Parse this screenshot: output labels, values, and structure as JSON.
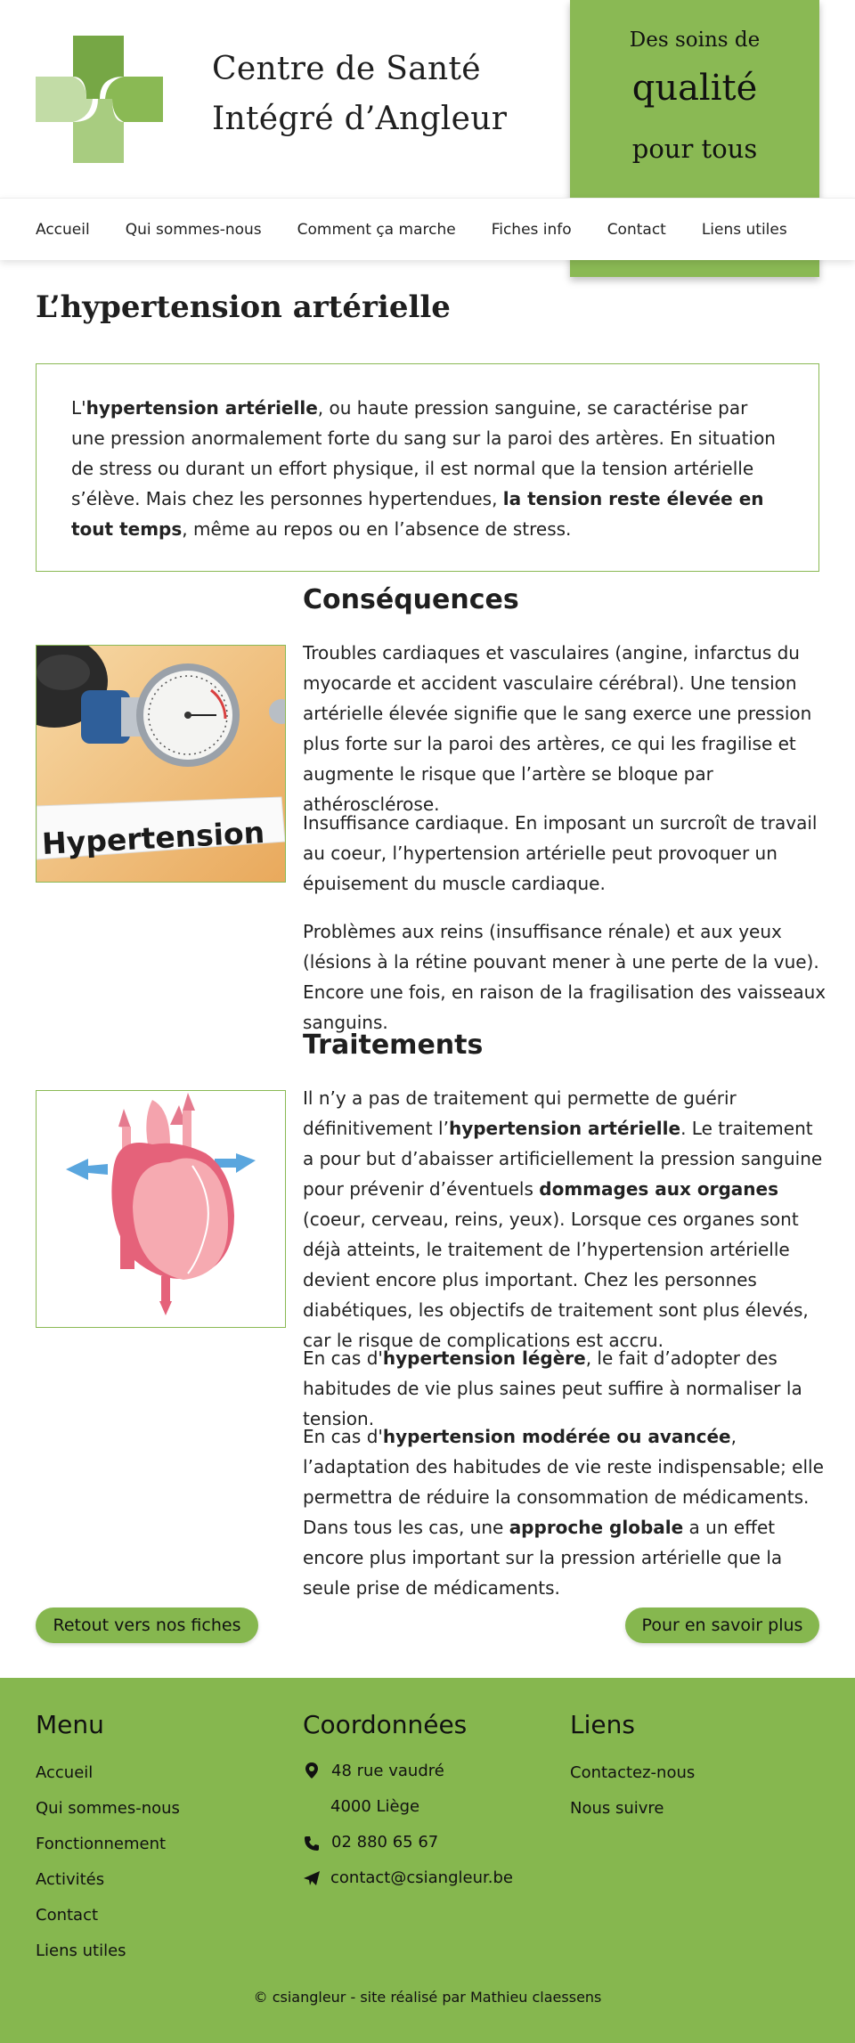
{
  "header": {
    "site_name_line1": "Centre de Santé",
    "site_name_line2": "Intégré d’Angleur",
    "slogan_line1": "Des soins de",
    "slogan_line2": "qualité",
    "slogan_line3": "pour tous",
    "logo_icon": "green-cross-logo"
  },
  "nav": {
    "items": [
      "Accueil",
      "Qui sommes-nous",
      "Comment ça marche",
      "Fiches info",
      "Contact",
      "Liens utiles"
    ]
  },
  "page": {
    "title": "L’hypertension artérielle"
  },
  "intro": {
    "p1": "L'",
    "b1": "hypertension artérielle",
    "p2": ", ou haute pression sanguine, se caractérise par une pression anormalement forte du sang sur la paroi des artères. En situation de stress ou durant un effort physique, il est normal que la tension artérielle s’élève. Mais chez les personnes hypertendues, ",
    "b2": "la tension reste élevée en tout temps",
    "p3": ", même au repos ou en l’absence de stress."
  },
  "consequences": {
    "title": "Conséquences",
    "image_label": "Hypertension",
    "para1": "Troubles cardiaques et vasculaires (angine, infarctus du myocarde et accident vasculaire cérébral). Une tension artérielle élevée signifie que le sang exerce une pression plus forte sur la paroi des artères, ce qui les fragilise et augmente le risque que l’artère se bloque par athérosclérose.",
    "para2": "Insuffisance cardiaque. En imposant un surcroît de travail au coeur, l’hypertension artérielle peut provoquer un épuisement du muscle cardiaque.",
    "para3": "Problèmes aux reins (insuffisance rénale) et aux yeux (lésions à la rétine pouvant mener à une perte de la vue). Encore une fois, en raison de la fragilisation des vaisseaux sanguins."
  },
  "traitements": {
    "title": "Traitements",
    "p1_a": "Il n’y a pas de traitement qui permette de guérir définitivement l’",
    "p1_b": "hypertension artérielle",
    "p1_c": ". Le traitement a pour but d’abaisser artificiellement la pression sanguine pour prévenir d’éventuels ",
    "p1_d": "dommages aux organes",
    "p1_e": " (coeur, cerveau, reins, yeux). Lorsque ces organes sont déjà atteints, le traitement de l’hypertension artérielle devient encore plus important. Chez les personnes diabétiques, les objectifs de traitement sont plus élevés, car le risque de complications est accru.",
    "p2_a": "En cas d'",
    "p2_b": "hypertension légère",
    "p2_c": ", le fait d’adopter des habitudes de vie plus saines peut suffire à normaliser la tension.",
    "p3_a": "En cas d'",
    "p3_b": "hypertension modérée ou avancée",
    "p3_c": ", l’adaptation des habitudes de vie reste indispensable; elle permettra de réduire la consommation de médicaments. Dans tous les cas, une ",
    "p3_d": "approche globale",
    "p3_e": " a un effet encore plus important sur la pression artérielle que la seule prise de médicaments."
  },
  "buttons": {
    "back": "Retout vers nos fiches",
    "more": "Pour en savoir plus"
  },
  "footer": {
    "menu_title": "Menu",
    "menu_items": [
      "Accueil",
      "Qui sommes-nous",
      "Fonctionnement",
      "Activités",
      "Contact",
      "Liens utiles"
    ],
    "coord_title": "Coordonnées",
    "address1": "48 rue vaudré",
    "address2": "4000 Liège",
    "phone": "02 880 65 67",
    "email": "contact@csiangleur.be",
    "links_title": "Liens",
    "links_items": [
      "Contactez-nous",
      "Nous suivre"
    ],
    "copyright": "© csiangleur - site réalisé par Mathieu claessens",
    "icons": [
      "map-marker-icon",
      "phone-icon",
      "paper-plane-icon"
    ]
  },
  "colors": {
    "accent": "#8ab954",
    "footer_bg": "#86b74f"
  }
}
